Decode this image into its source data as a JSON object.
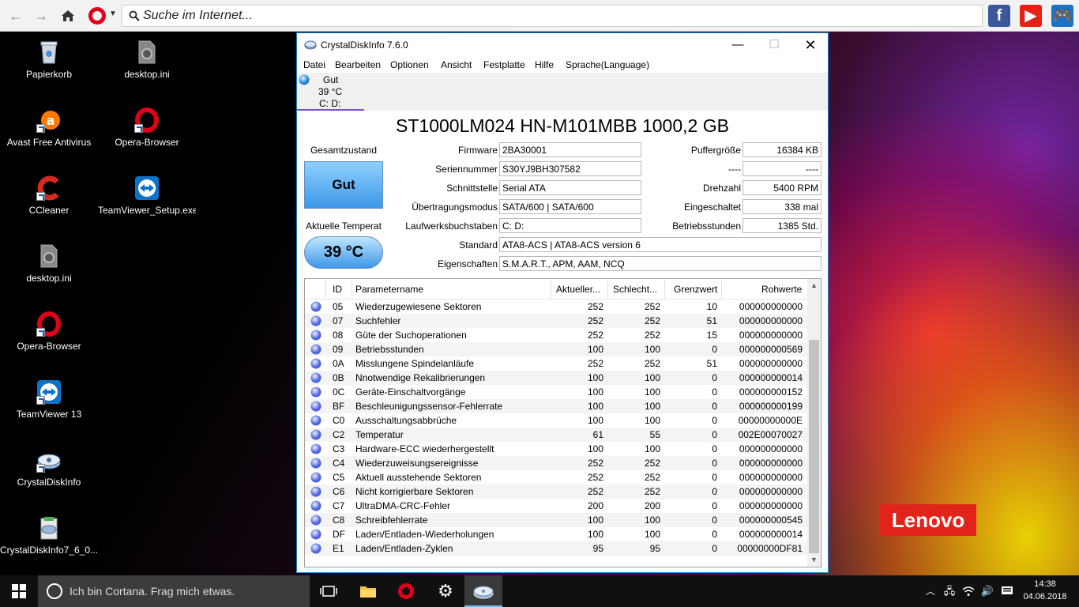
{
  "browser": {
    "search_placeholder": "Suche im Internet...",
    "speed_dials": [
      {
        "icon": "facebook-icon",
        "glyph": "f",
        "color": "#3b5998"
      },
      {
        "icon": "youtube-icon",
        "glyph": "▶",
        "color": "#e62117"
      },
      {
        "icon": "gamepad-icon",
        "glyph": "🎮",
        "color": "#1a73c9"
      }
    ]
  },
  "desktop": {
    "icons": [
      {
        "label": "Papierkorb",
        "icon": "recycle-bin-icon"
      },
      {
        "label": "desktop.ini",
        "icon": "settings-file-icon"
      },
      {
        "label": "Avast Free Antivirus",
        "icon": "avast-icon"
      },
      {
        "label": "Opera-Browser",
        "icon": "opera-icon"
      },
      {
        "label": "CCleaner",
        "icon": "ccleaner-icon"
      },
      {
        "label": "TeamViewer_Setup.exe",
        "icon": "teamviewer-icon"
      },
      {
        "label": "desktop.ini",
        "icon": "settings-file-icon"
      },
      {
        "label": "Opera-Browser",
        "icon": "opera-icon"
      },
      {
        "label": "TeamViewer 13",
        "icon": "teamviewer-icon"
      },
      {
        "label": "CrystalDiskInfo",
        "icon": "crystaldiskinfo-icon"
      },
      {
        "label": "CrystalDiskInfo7_6_0...",
        "icon": "installer-icon"
      }
    ],
    "brand": "Lenovo"
  },
  "cdi": {
    "title": "CrystalDiskInfo 7.6.0",
    "menu": [
      "Datei",
      "Bearbeiten",
      "Optionen",
      "Ansicht",
      "Festplatte",
      "Hilfe",
      "Sprache(Language)"
    ],
    "drive_tab": {
      "status": "Gut",
      "temp": "39 °C",
      "letters": "C: D:"
    },
    "disk_title": "ST1000LM024 HN-M101MBB 1000,2 GB",
    "health_label": "Gesamtzustand",
    "health_value": "Gut",
    "temp_label": "Aktuelle Temperat",
    "temp_value": "39 °C",
    "fields": {
      "firmware": {
        "label": "Firmware",
        "value": "2BA30001"
      },
      "serial": {
        "label": "Seriennummer",
        "value": "S30YJ9BH307582"
      },
      "interface": {
        "label": "Schnittstelle",
        "value": "Serial ATA"
      },
      "transfer": {
        "label": "Übertragungsmodus",
        "value": "SATA/600 | SATA/600"
      },
      "letters": {
        "label": "Laufwerksbuchstaben",
        "value": "C: D:"
      },
      "standard": {
        "label": "Standard",
        "value": "ATA8-ACS | ATA8-ACS version 6"
      },
      "features": {
        "label": "Eigenschaften",
        "value": "S.M.A.R.T., APM, AAM, NCQ"
      },
      "buffer": {
        "label": "Puffergröße",
        "value": "16384 KB"
      },
      "nv": {
        "label": "----",
        "value": "----"
      },
      "rpm": {
        "label": "Drehzahl",
        "value": "5400 RPM"
      },
      "power_on_count": {
        "label": "Eingeschaltet",
        "value": "338 mal"
      },
      "power_on_hours": {
        "label": "Betriebsstunden",
        "value": "1385 Std."
      }
    },
    "smart_headers": [
      "ID",
      "Parametername",
      "Aktueller...",
      "Schlecht...",
      "Grenzwert",
      "Rohwerte"
    ],
    "smart_rows": [
      {
        "id": "05",
        "name": "Wiederzugewiesene Sektoren",
        "cur": "252",
        "worst": "252",
        "thr": "10",
        "raw": "000000000000"
      },
      {
        "id": "07",
        "name": "Suchfehler",
        "cur": "252",
        "worst": "252",
        "thr": "51",
        "raw": "000000000000"
      },
      {
        "id": "08",
        "name": "Güte der Suchoperationen",
        "cur": "252",
        "worst": "252",
        "thr": "15",
        "raw": "000000000000"
      },
      {
        "id": "09",
        "name": "Betriebsstunden",
        "cur": "100",
        "worst": "100",
        "thr": "0",
        "raw": "000000000569"
      },
      {
        "id": "0A",
        "name": "Misslungene Spindelanläufe",
        "cur": "252",
        "worst": "252",
        "thr": "51",
        "raw": "000000000000"
      },
      {
        "id": "0B",
        "name": "Nnotwendige Rekalibrierungen",
        "cur": "100",
        "worst": "100",
        "thr": "0",
        "raw": "000000000014"
      },
      {
        "id": "0C",
        "name": "Geräte-Einschaltvorgänge",
        "cur": "100",
        "worst": "100",
        "thr": "0",
        "raw": "000000000152"
      },
      {
        "id": "BF",
        "name": "Beschleunigungssensor-Fehlerrate",
        "cur": "100",
        "worst": "100",
        "thr": "0",
        "raw": "000000000199"
      },
      {
        "id": "C0",
        "name": "Ausschaltungsabbrüche",
        "cur": "100",
        "worst": "100",
        "thr": "0",
        "raw": "00000000000E"
      },
      {
        "id": "C2",
        "name": "Temperatur",
        "cur": "61",
        "worst": "55",
        "thr": "0",
        "raw": "002E00070027"
      },
      {
        "id": "C3",
        "name": "Hardware-ECC wiederhergestellt",
        "cur": "100",
        "worst": "100",
        "thr": "0",
        "raw": "000000000000"
      },
      {
        "id": "C4",
        "name": "Wiederzuweisungsereignisse",
        "cur": "252",
        "worst": "252",
        "thr": "0",
        "raw": "000000000000"
      },
      {
        "id": "C5",
        "name": "Aktuell ausstehende Sektoren",
        "cur": "252",
        "worst": "252",
        "thr": "0",
        "raw": "000000000000"
      },
      {
        "id": "C6",
        "name": "Nicht korrigierbare Sektoren",
        "cur": "252",
        "worst": "252",
        "thr": "0",
        "raw": "000000000000"
      },
      {
        "id": "C7",
        "name": "UltraDMA-CRC-Fehler",
        "cur": "200",
        "worst": "200",
        "thr": "0",
        "raw": "000000000000"
      },
      {
        "id": "C8",
        "name": "Schreibfehlerrate",
        "cur": "100",
        "worst": "100",
        "thr": "0",
        "raw": "000000000545"
      },
      {
        "id": "DF",
        "name": "Laden/Entladen-Wiederholungen",
        "cur": "100",
        "worst": "100",
        "thr": "0",
        "raw": "000000000014"
      },
      {
        "id": "E1",
        "name": "Laden/Entladen-Zyklen",
        "cur": "95",
        "worst": "95",
        "thr": "0",
        "raw": "00000000DF81"
      }
    ]
  },
  "taskbar": {
    "cortana_placeholder": "Ich bin Cortana. Frag mich etwas.",
    "time": "14:38",
    "date": "04.06.2018"
  }
}
